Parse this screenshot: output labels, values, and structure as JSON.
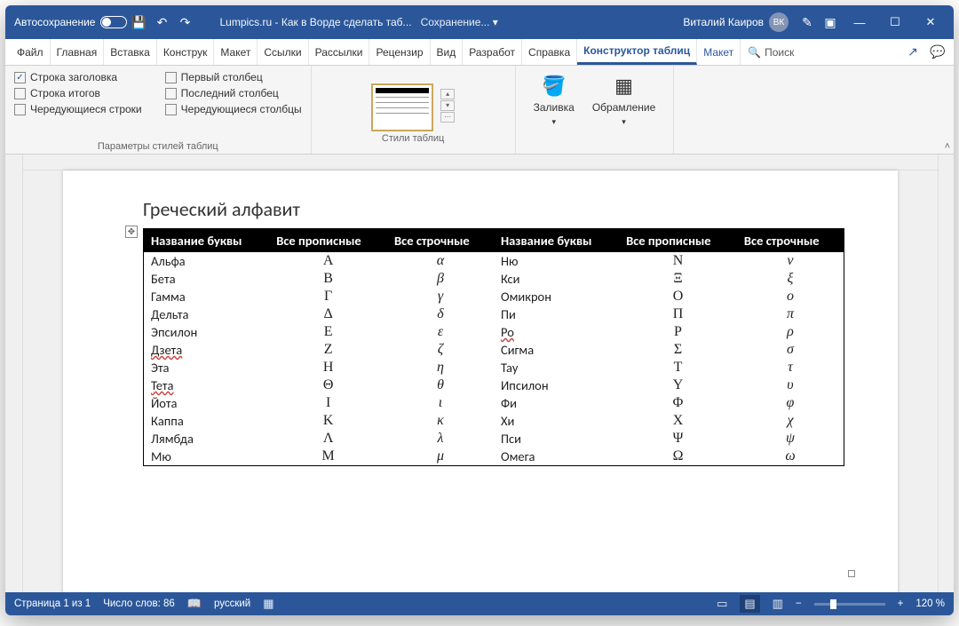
{
  "titlebar": {
    "autosave": "Автосохранение",
    "doc": "Lumpics.ru - Как в Ворде сделать таб...",
    "saving": "Сохранение...",
    "user": "Виталий Каиров",
    "initials": "ВК"
  },
  "tabs": {
    "file": "Файл",
    "home": "Главная",
    "insert": "Вставка",
    "design": "Конструк",
    "layout": "Макет",
    "refs": "Ссылки",
    "mail": "Рассылки",
    "review": "Рецензир",
    "view": "Вид",
    "dev": "Разработ",
    "help": "Справка",
    "tdesign": "Конструктор таблиц",
    "tlayout": "Макет",
    "search": "Поиск"
  },
  "ribbon": {
    "opt1": "Строка заголовка",
    "opt2": "Строка итогов",
    "opt3": "Чередующиеся строки",
    "opt4": "Первый столбец",
    "opt5": "Последний столбец",
    "opt6": "Чередующиеся столбцы",
    "g1": "Параметры стилей таблиц",
    "g2": "Стили таблиц",
    "fill": "Заливка",
    "border": "Обрамление"
  },
  "doc": {
    "heading": "Греческий алфавит",
    "th1": "Название буквы",
    "th2": "Все прописные",
    "th3": "Все строчные",
    "th4": "Название буквы",
    "th5": "Все прописные",
    "th6": "Все строчные",
    "rows": [
      {
        "n1": "Альфа",
        "u1": "Α",
        "l1": "α",
        "n2": "Ню",
        "u2": "Ν",
        "l2": "ν"
      },
      {
        "n1": "Бета",
        "u1": "Β",
        "l1": "β",
        "n2": "Кси",
        "u2": "Ξ",
        "l2": "ξ"
      },
      {
        "n1": "Гамма",
        "u1": "Γ",
        "l1": "γ",
        "n2": "Омикрон",
        "u2": "Ο",
        "l2": "ο"
      },
      {
        "n1": "Дельта",
        "u1": "Δ",
        "l1": "δ",
        "n2": "Пи",
        "u2": "Π",
        "l2": "π"
      },
      {
        "n1": "Эпсилон",
        "u1": "Ε",
        "l1": "ε",
        "n2": "Ро",
        "u2": "Ρ",
        "l2": "ρ",
        "s2": true
      },
      {
        "n1": "Дзета",
        "u1": "Ζ",
        "l1": "ζ",
        "n2": "Сигма",
        "u2": "Σ",
        "l2": "σ",
        "s1": true
      },
      {
        "n1": "Эта",
        "u1": "Η",
        "l1": "η",
        "n2": "Тау",
        "u2": "Τ",
        "l2": "τ"
      },
      {
        "n1": "Тета",
        "u1": "Θ",
        "l1": "θ",
        "n2": "Ипсилон",
        "u2": "Υ",
        "l2": "υ",
        "s1": true
      },
      {
        "n1": "Йота",
        "u1": "Ι",
        "l1": "ι",
        "n2": "Фи",
        "u2": "Φ",
        "l2": "φ"
      },
      {
        "n1": "Каппа",
        "u1": "Κ",
        "l1": "κ",
        "n2": "Хи",
        "u2": "Χ",
        "l2": "χ"
      },
      {
        "n1": "Лямбда",
        "u1": "Λ",
        "l1": "λ",
        "n2": "Пси",
        "u2": "Ψ",
        "l2": "ψ"
      },
      {
        "n1": "Мю",
        "u1": "Μ",
        "l1": "μ",
        "n2": "Омега",
        "u2": "Ω",
        "l2": "ω"
      }
    ]
  },
  "status": {
    "page": "Страница 1 из 1",
    "words": "Число слов: 86",
    "lang": "русский",
    "zoom": "120 %"
  }
}
